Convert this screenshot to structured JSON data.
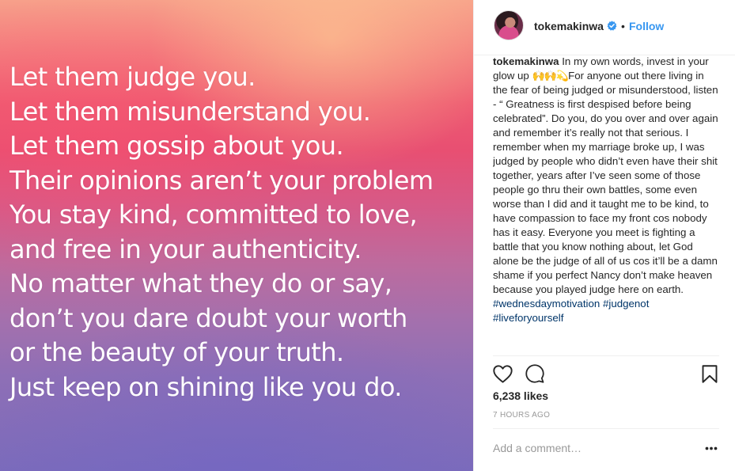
{
  "post_image": {
    "quote_lines": [
      "Let them judge you.",
      "Let them misunderstand you.",
      "Let them gossip about you.",
      "Their opinions aren’t your problem",
      "You stay kind, committed to love,",
      "and free in your authenticity.",
      "No matter what they do or say,",
      "don’t you dare doubt your worth",
      "or the beauty of your truth.",
      "Just keep on shining like you do."
    ]
  },
  "header": {
    "username": "tokemakinwa",
    "verified": true,
    "separator": "•",
    "follow_label": "Follow"
  },
  "caption": {
    "username": "tokemakinwa",
    "text_1": "In my own words, invest in your glow up",
    "emojis": "🙌🙌💫",
    "text_2": "For anyone out there living in the fear of being judged or misunderstood, listen - “ Greatness is first despised before being celebrated”. Do you, do you over and over again and remember it’s really not that serious. I remember when my marriage broke up, I was judged by people who didn’t even have their shit together, years after I’ve seen some of those people go thru their own battles, some even worse than I did and it taught me to be kind, to have compassion to face my front cos nobody has it easy. Everyone you meet is fighting a battle that you know nothing about, let God alone be the judge of all of us cos it’ll be a damn shame if you perfect Nancy don’t make heaven because you played judge here on earth.",
    "hashtags": [
      "#wednesdaymotivation",
      "#judgenot",
      "#liveforyourself"
    ]
  },
  "actions": {
    "like_icon": "heart-outline-icon",
    "comment_icon": "speech-bubble-icon",
    "save_icon": "bookmark-icon"
  },
  "likes": "6,238 likes",
  "timestamp": "7 HOURS AGO",
  "comment_box": {
    "placeholder": "Add a comment…",
    "more_icon": "ellipsis-icon"
  },
  "colors": {
    "link_blue": "#3897f0",
    "hashtag_blue": "#003569",
    "text_dark": "#262626",
    "text_muted": "#999999",
    "divider": "#efefef"
  }
}
